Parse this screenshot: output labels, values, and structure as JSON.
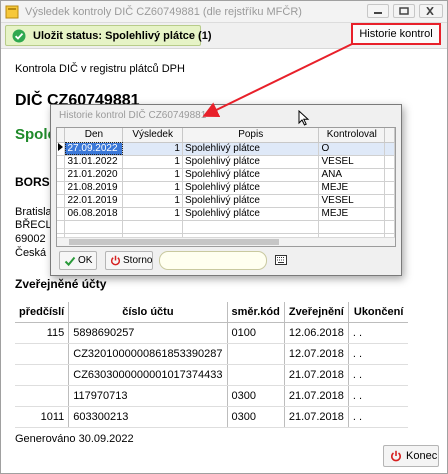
{
  "window": {
    "title": "Výsledek kontroly DIČ CZ60749881 (dle rejstříku MFČR)"
  },
  "toolbar": {
    "status_label": "Uložit status: Spolehlivý plátce (1)",
    "history_label": "Historie kontrol"
  },
  "report": {
    "heading": "Kontrola DIČ v registru plátců DPH",
    "dic": "DIČ CZ60749881",
    "status_partial": "Spole",
    "name_partial": "BORS",
    "address_lines": [
      "Bratislav",
      "BŘECLA",
      "69002",
      "Česká r"
    ],
    "accounts_title": "Zveřejněné účty",
    "generated": "Generováno 30.09.2022"
  },
  "accounts": {
    "columns": [
      "předčíslí",
      "číslo účtu",
      "směr.kód",
      "Zveřejnění",
      "Ukončení"
    ],
    "rows": [
      [
        "115",
        "5898690257",
        "0100",
        "12.06.2018",
        ". ."
      ],
      [
        "",
        "CZ3201000000861853390287",
        "",
        "12.07.2018",
        ". ."
      ],
      [
        "",
        "CZ6303000000001017374433",
        "",
        "21.07.2018",
        ". ."
      ],
      [
        "",
        "117970713",
        "0300",
        "21.07.2018",
        ". ."
      ],
      [
        "1011",
        "603300213",
        "0300",
        "21.07.2018",
        ". ."
      ]
    ]
  },
  "footer": {
    "close_label": "Konec"
  },
  "dialog": {
    "title": "Historie kontrol DIČ CZ60749881",
    "columns": [
      "Den",
      "Výsledek",
      "Popis",
      "Kontroloval"
    ],
    "rows": [
      [
        "27.09.2022",
        "1",
        "Spolehlivý plátce",
        "O"
      ],
      [
        "31.01.2022",
        "1",
        "Spolehlivý plátce",
        "VESEL"
      ],
      [
        "21.01.2020",
        "1",
        "Spolehlivý plátce",
        "ANA"
      ],
      [
        "21.08.2019",
        "1",
        "Spolehlivý plátce",
        "MEJE"
      ],
      [
        "22.01.2019",
        "1",
        "Spolehlivý plátce",
        "VESEL"
      ],
      [
        "06.08.2018",
        "1",
        "Spolehlivý plátce",
        "MEJE"
      ]
    ],
    "ok_label": "OK",
    "cancel_label": "Storno",
    "search_value": ""
  },
  "colors": {
    "status_green": "#1f8a2a",
    "highlight_red": "#e8202a",
    "selection_blue": "#3b78d8"
  }
}
